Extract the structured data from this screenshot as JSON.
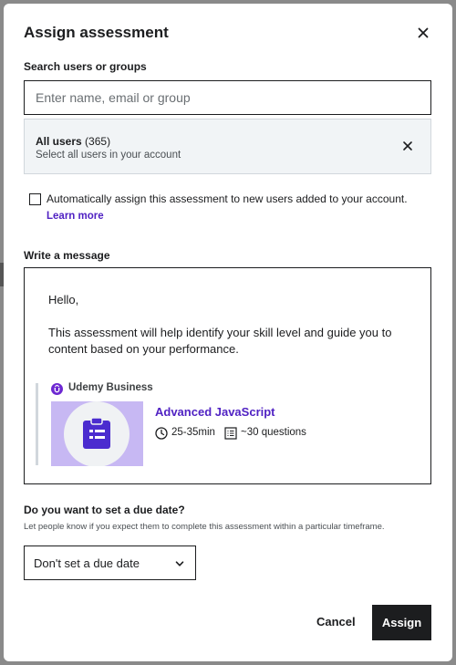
{
  "dialog": {
    "title": "Assign assessment",
    "search_label": "Search users or groups",
    "search_placeholder": "Enter name, email or group",
    "all_users": {
      "name": "All users",
      "count": "(365)",
      "subtitle": "Select all users in your account"
    },
    "auto_assign_text": "Automatically assign this assessment to new users added to your account.",
    "learn_more": "Learn more",
    "message_label": "Write a message",
    "message": {
      "greeting": "Hello,",
      "body": "This assessment will help identify your skill level and guide you to content based on your performance."
    },
    "card": {
      "brand": "Udemy Business",
      "course_title": "Advanced JavaScript",
      "duration": "25-35min",
      "questions": "~30 questions"
    },
    "due_date_label": "Do you want to set a due date?",
    "due_date_help": "Let people know if you expect them to complete this assessment within a particular timeframe.",
    "due_date_select": "Don't set a due date",
    "cancel": "Cancel",
    "assign": "Assign"
  },
  "colors": {
    "accent": "#5022c3",
    "thumbnail": "#c7b8f3",
    "icon": "#4b2ccf",
    "button_dark": "#1c1d1f"
  },
  "icons": [
    "close-icon",
    "udemy-logo-icon",
    "clipboard-icon",
    "clock-icon",
    "list-icon",
    "chevron-down-icon"
  ]
}
